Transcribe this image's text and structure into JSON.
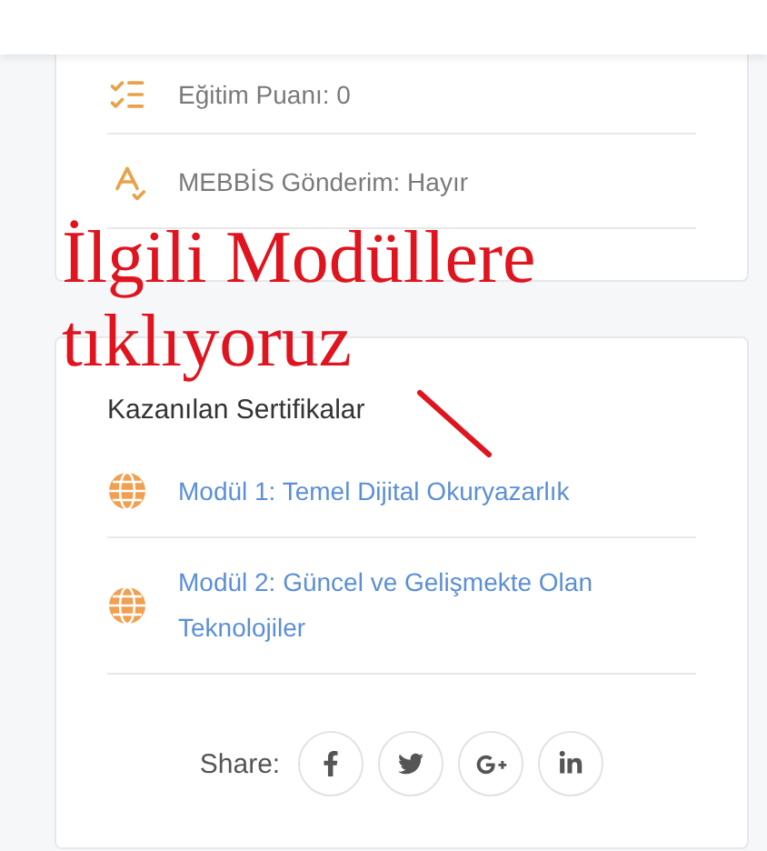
{
  "stats": [
    {
      "kind": "score",
      "text": "Eğitim Puanı: 0"
    },
    {
      "kind": "mebbis",
      "text": "MEBBİS Gönderim: Hayır"
    }
  ],
  "certificates": {
    "heading": "Kazanılan Sertifikalar",
    "items": [
      "Modül 1: Temel Dijital Okuryazarlık",
      "Modül 2: Güncel ve Gelişmekte Olan Teknolojiler"
    ]
  },
  "share": {
    "label": "Share:",
    "networks": [
      {
        "kind": "facebook"
      },
      {
        "kind": "twitter"
      },
      {
        "kind": "google-plus"
      },
      {
        "kind": "linkedin"
      }
    ]
  },
  "annotation": {
    "lines": [
      "İlgili Modüllere",
      "tıklıyoruz"
    ]
  }
}
